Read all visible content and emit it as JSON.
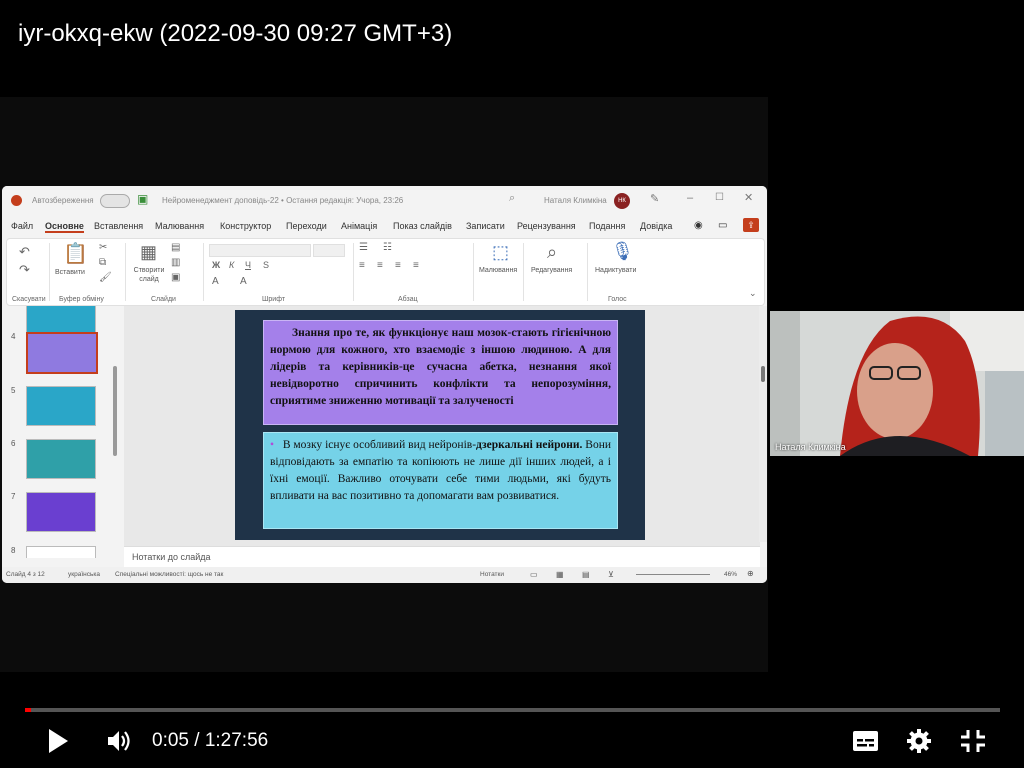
{
  "video": {
    "title": "iyr-okxq-ekw (2022-09-30 09:27 GMT+3)",
    "time_current": "0:05",
    "time_separator": "/",
    "time_total": "1:27:56",
    "progress_fraction": 0.006
  },
  "ppt": {
    "autosave_label": "Автозбереження",
    "doc_title": "Нейроменеджмент доповідь-22 • Остання редакція: Учора, 23:26",
    "user_name": "Наталя Климкіна",
    "user_initials": "НК",
    "tabs": [
      "Файл",
      "Основне",
      "Вставлення",
      "Малювання",
      "Конструктор",
      "Переходи",
      "Анімація",
      "Показ слайдів",
      "Записати",
      "Рецензування",
      "Подання",
      "Довідка"
    ],
    "active_tab": "Основне",
    "ribbon": {
      "undo_group": "Скасувати",
      "paste_label": "Вставити",
      "clipboard_group": "Буфер обміну",
      "new_slide_label": "Створити слайд",
      "slides_group": "Слайди",
      "font_group": "Шрифт",
      "paragraph_group": "Абзац",
      "drawing_label": "Малювання",
      "editing_label": "Редагування",
      "dictate_label": "Надиктувати",
      "voice_group": "Голос"
    },
    "thumbnails": [
      {
        "num": "4",
        "color": "#8f7ae0",
        "selected": true
      },
      {
        "num": "5",
        "color": "#2aa6c8",
        "selected": false
      },
      {
        "num": "6",
        "color": "#2fa0a8",
        "selected": false
      },
      {
        "num": "7",
        "color": "#6a3fd0",
        "selected": false
      },
      {
        "num": "8",
        "color": "#ffffff",
        "selected": false
      }
    ],
    "slide": {
      "box1_text": "Знання про те, як функціонує наш мозок-стають гігієнічною нормою для кожного, хто взаємодіє з іншою людиною. А для лідерів та керівників-це сучасна абетка, незнання якої невідворотно спричинить конфлікти та непорозуміння, сприятиме зниженню мотивації та залученості",
      "box2_bullet": "•",
      "box2_lead": "В мозку існує особливий вид нейронів-",
      "box2_bold": "дзеркальні нейрони.",
      "box2_rest": " Вони відповідають за емпатію та копіюють не лише дії інших людей, а і їхні емоції. Важливо оточувати себе тими людьми, які будуть впливати на вас позитивно та допомагати вам розвиватися."
    },
    "notes_placeholder": "Нотатки до слайда",
    "status": {
      "slide_of": "Слайд 4 з 12",
      "language": "українська",
      "accessibility": "Спеціальні можливості: щось не так",
      "notes_btn": "Нотатки",
      "zoom": "46%"
    }
  },
  "webcam": {
    "name": "Наталя Климкіна"
  },
  "colors": {
    "progress_played": "#ff0000",
    "ppt_accent": "#c43e1c"
  }
}
